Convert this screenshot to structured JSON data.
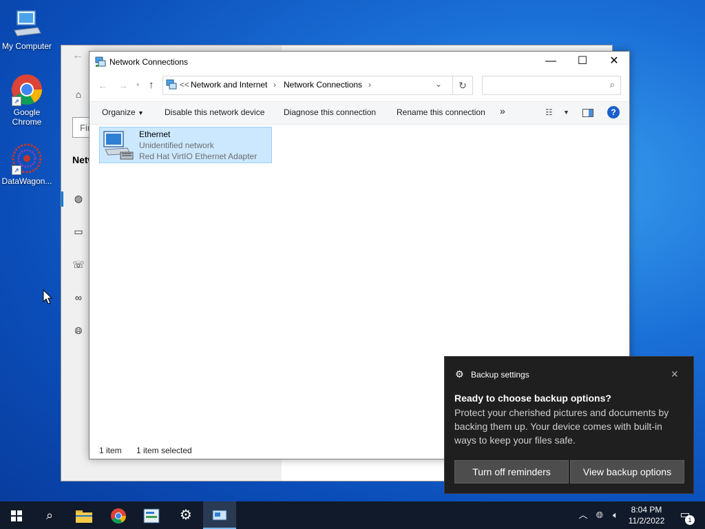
{
  "desktop": {
    "icons": [
      {
        "label": "My Computer"
      },
      {
        "label": "Google Chrome"
      },
      {
        "label": "DataWagon..."
      }
    ]
  },
  "settings_window": {
    "search_placeholder": "Fir",
    "nav_heading": "Netw"
  },
  "network_window": {
    "title": "Network Connections",
    "breadcrumb": {
      "overflow": "<<",
      "items": [
        "Network and Internet",
        "Network Connections"
      ]
    },
    "search_placeholder": "",
    "commands": {
      "organize": "Organize",
      "disable": "Disable this network device",
      "diagnose": "Diagnose this connection",
      "rename": "Rename this connection",
      "more": "»"
    },
    "item": {
      "name": "Ethernet",
      "status": "Unidentified network",
      "adapter": "Red Hat VirtIO Ethernet Adapter"
    },
    "status_bar": {
      "count": "1 item",
      "selected": "1 item selected"
    }
  },
  "toast": {
    "app": "Backup settings",
    "heading": "Ready to choose backup options?",
    "body": "Protect your cherished pictures and documents by backing them up. Your device comes with built-in ways to keep your files safe.",
    "button_primary": "Turn off reminders",
    "button_secondary": "View backup options"
  },
  "taskbar": {
    "time": "8:04 PM",
    "date": "11/2/2022",
    "notification_count": "1"
  },
  "colors": {
    "accent": "#0078d7",
    "selection": "#cce8ff",
    "toast_bg": "#1f1f1f",
    "taskbar_bg": "#101a2a"
  }
}
